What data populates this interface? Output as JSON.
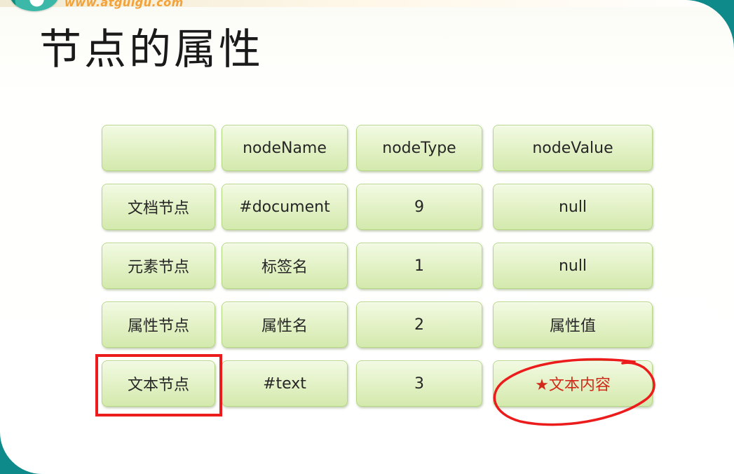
{
  "header": {
    "logo_text": "www.atguigu.com",
    "title": "节点的属性"
  },
  "table": {
    "columns": [
      "",
      "nodeName",
      "nodeType",
      "nodeValue"
    ],
    "rows": [
      [
        "文档节点",
        "#document",
        "9",
        "null"
      ],
      [
        "元素节点",
        "标签名",
        "1",
        "null"
      ],
      [
        "属性节点",
        "属性名",
        "2",
        "属性值"
      ],
      [
        "文本节点",
        "#text",
        "3",
        "★文本内容"
      ]
    ]
  },
  "colors": {
    "cell_fill": "#e2f1c4",
    "cell_border": "#b6d783",
    "annotation_red": "#ec1c1c",
    "emphasis_text": "#d22a1a",
    "frame": "#0f8a8a"
  }
}
